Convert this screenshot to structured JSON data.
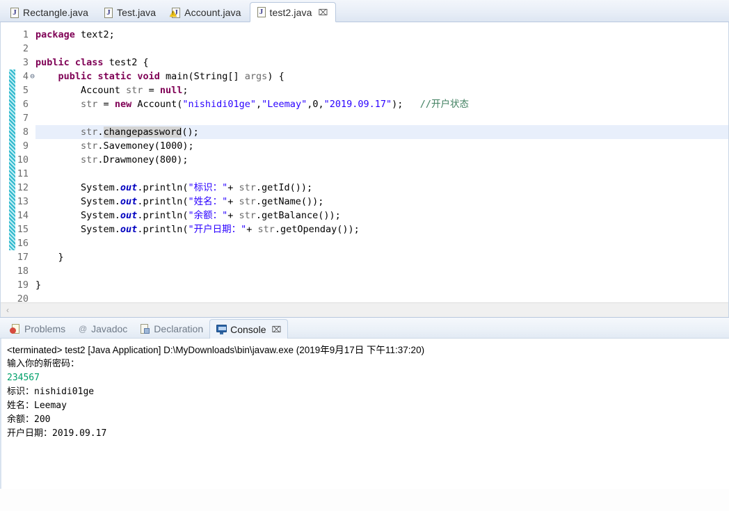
{
  "editor_tabs": [
    {
      "label": "Rectangle.java",
      "icon": "java-file-icon",
      "active": false,
      "warning": false
    },
    {
      "label": "Test.java",
      "icon": "java-file-icon",
      "active": false,
      "warning": false
    },
    {
      "label": "Account.java",
      "icon": "java-file-icon-warning",
      "active": false,
      "warning": true
    },
    {
      "label": "test2.java",
      "icon": "java-file-icon",
      "active": true,
      "warning": false,
      "close": "⌧"
    }
  ],
  "code": {
    "line_numbers": [
      "1",
      "2",
      "3",
      "4",
      "5",
      "6",
      "7",
      "8",
      "9",
      "10",
      "11",
      "12",
      "13",
      "14",
      "15",
      "16",
      "17",
      "18",
      "19",
      "20"
    ],
    "fold_marker_line": 4,
    "fold_glyph": "⊖",
    "current_line": 8,
    "change_bar_from_line": 4,
    "change_bar_to_line": 17,
    "lines": [
      {
        "n": 1,
        "text": "package text2;"
      },
      {
        "n": 2,
        "text": ""
      },
      {
        "n": 3,
        "text": "public class test2 {"
      },
      {
        "n": 4,
        "text": "    public static void main(String[] args) {"
      },
      {
        "n": 5,
        "text": "        Account str = null;"
      },
      {
        "n": 6,
        "text": "        str = new Account(\"nishidi01ge\",\"Leemay\",0,\"2019.09.17\");   //开户状态"
      },
      {
        "n": 7,
        "text": ""
      },
      {
        "n": 8,
        "text": "        str.changepassword();"
      },
      {
        "n": 9,
        "text": "        str.Savemoney(1000);"
      },
      {
        "n": 10,
        "text": "        str.Drawmoney(800);"
      },
      {
        "n": 11,
        "text": ""
      },
      {
        "n": 12,
        "text": "        System.out.println(\"标识：\"+ str.getId());"
      },
      {
        "n": 13,
        "text": "        System.out.println(\"姓名：\"+ str.getName());"
      },
      {
        "n": 14,
        "text": "        System.out.println(\"余额：\"+ str.getBalance());"
      },
      {
        "n": 15,
        "text": "        System.out.println(\"开户日期：\"+ str.getOpenday());"
      },
      {
        "n": 16,
        "text": ""
      },
      {
        "n": 17,
        "text": "    }"
      },
      {
        "n": 18,
        "text": ""
      },
      {
        "n": 19,
        "text": "}"
      },
      {
        "n": 20,
        "text": ""
      }
    ],
    "tokens": {
      "keywords": [
        "package",
        "public",
        "class",
        "static",
        "void",
        "null",
        "new"
      ],
      "strings": [
        "\"nishidi01ge\"",
        "\"Leemay\"",
        "\"2019.09.17\"",
        "\"标识：\"",
        "\"姓名：\"",
        "\"余额：\"",
        "\"开户日期：\""
      ],
      "comment": "//开户状态",
      "static_field": "out",
      "occurrence_highlight": "changepassword"
    },
    "scrollbar": {
      "left_arrow": "‹"
    }
  },
  "panel": {
    "tabs": [
      {
        "label": "Problems",
        "icon": "problems-icon",
        "active": false
      },
      {
        "label": "Javadoc",
        "icon": "javadoc-icon",
        "active": false
      },
      {
        "label": "Declaration",
        "icon": "declaration-icon",
        "active": false
      },
      {
        "label": "Console",
        "icon": "console-icon",
        "active": true,
        "close": "⌧"
      }
    ],
    "console": {
      "header": "<terminated> test2 [Java Application] D:\\MyDownloads\\bin\\javaw.exe (2019年9月17日 下午11:37:20)",
      "lines": [
        {
          "text": "输入你的新密码：",
          "kind": "output"
        },
        {
          "text": "234567",
          "kind": "input"
        },
        {
          "text": "标识：nishidi01ge",
          "kind": "output"
        },
        {
          "text": "姓名：Leemay",
          "kind": "output"
        },
        {
          "text": "余额：200",
          "kind": "output"
        },
        {
          "text": "开户日期：2019.09.17",
          "kind": "output"
        }
      ]
    }
  },
  "colors": {
    "keyword": "#7f0055",
    "string": "#2a00ff",
    "comment": "#3f7f5f",
    "static_field": "#0000c0",
    "console_input": "#00a06a",
    "current_line_bg": "#e8effb",
    "change_bar": "#57c9da",
    "tab_active_bg": "#ffffff"
  }
}
